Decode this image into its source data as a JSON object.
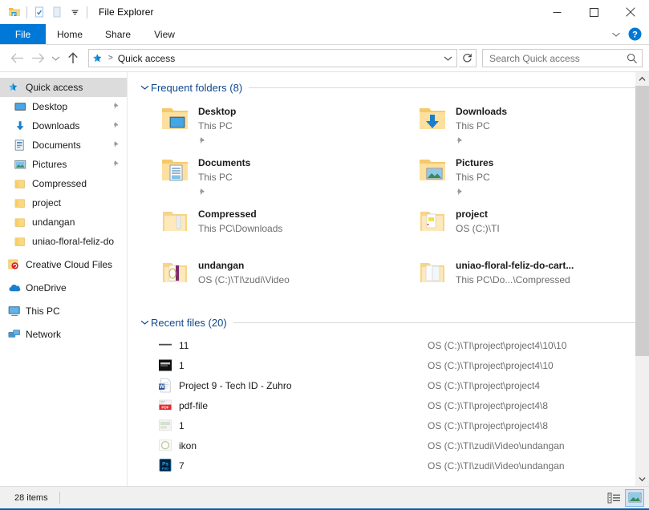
{
  "window": {
    "title": "File Explorer",
    "quick_access_toolbar": [
      {
        "name": "folder-icon",
        "label": "File Explorer"
      },
      {
        "name": "properties-icon",
        "label": "Properties"
      },
      {
        "name": "new-folder-icon",
        "label": "New folder"
      },
      {
        "name": "customize-dropdown-icon",
        "label": "Customize Quick Access Toolbar"
      }
    ],
    "controls": {
      "minimize": "Minimize",
      "maximize": "Maximize",
      "close": "Close"
    }
  },
  "ribbon": {
    "tabs": [
      {
        "label": "File",
        "active": true
      },
      {
        "label": "Home",
        "active": false
      },
      {
        "label": "Share",
        "active": false
      },
      {
        "label": "View",
        "active": false
      }
    ],
    "expand_label": "Expand the Ribbon",
    "help_label": "Help"
  },
  "navigation": {
    "back_label": "Back",
    "forward_label": "Forward",
    "recent_label": "Recent locations",
    "up_label": "Up",
    "breadcrumb": {
      "icon": "quick-access-star-icon",
      "separator": ">",
      "path": "Quick access"
    },
    "address_dropdown_label": "Previous locations",
    "refresh_label": "Refresh"
  },
  "search": {
    "placeholder": "Search Quick access",
    "value": "",
    "icon": "search-icon"
  },
  "sidebar": {
    "items": [
      {
        "label": "Quick access",
        "icon": "quick-access-star-icon",
        "selected": true,
        "pinned": false,
        "indent": "root"
      },
      {
        "label": "Desktop",
        "icon": "desktop-icon",
        "selected": false,
        "pinned": true,
        "indent": "child"
      },
      {
        "label": "Downloads",
        "icon": "downloads-arrow-icon",
        "selected": false,
        "pinned": true,
        "indent": "child"
      },
      {
        "label": "Documents",
        "icon": "documents-icon",
        "selected": false,
        "pinned": true,
        "indent": "child"
      },
      {
        "label": "Pictures",
        "icon": "pictures-icon",
        "selected": false,
        "pinned": true,
        "indent": "child"
      },
      {
        "label": "Compressed",
        "icon": "folder-icon",
        "selected": false,
        "pinned": false,
        "indent": "child"
      },
      {
        "label": "project",
        "icon": "folder-icon",
        "selected": false,
        "pinned": false,
        "indent": "child"
      },
      {
        "label": "undangan",
        "icon": "folder-icon",
        "selected": false,
        "pinned": false,
        "indent": "child"
      },
      {
        "label": "uniao-floral-feliz-do",
        "icon": "folder-icon",
        "selected": false,
        "pinned": false,
        "indent": "child"
      },
      {
        "label": "Creative Cloud Files",
        "icon": "creative-cloud-icon",
        "selected": false,
        "pinned": false,
        "indent": "root"
      },
      {
        "label": "OneDrive",
        "icon": "onedrive-cloud-icon",
        "selected": false,
        "pinned": false,
        "indent": "root"
      },
      {
        "label": "This PC",
        "icon": "this-pc-icon",
        "selected": false,
        "pinned": false,
        "indent": "root"
      },
      {
        "label": "Network",
        "icon": "network-icon",
        "selected": false,
        "pinned": false,
        "indent": "root"
      }
    ]
  },
  "main": {
    "frequent_folders": {
      "title": "Frequent folders (8)",
      "collapsed": false,
      "items": [
        {
          "name": "Desktop",
          "location": "This PC",
          "icon": "folder-desktop-icon",
          "pinned": true
        },
        {
          "name": "Downloads",
          "location": "This PC",
          "icon": "folder-downloads-icon",
          "pinned": true
        },
        {
          "name": "Documents",
          "location": "This PC",
          "icon": "folder-documents-icon",
          "pinned": true
        },
        {
          "name": "Pictures",
          "location": "This PC",
          "icon": "folder-pictures-icon",
          "pinned": true
        },
        {
          "name": "Compressed",
          "location": "This PC\\Downloads",
          "icon": "folder-generic-icon",
          "pinned": false
        },
        {
          "name": "project",
          "location": "OS (C:)\\TI",
          "icon": "folder-generic-icon",
          "pinned": false
        },
        {
          "name": "undangan",
          "location": "OS (C:)\\TI\\zudi\\Video",
          "icon": "folder-generic-icon",
          "pinned": false
        },
        {
          "name": "uniao-floral-feliz-do-cart...",
          "location": "This PC\\Do...\\Compressed",
          "icon": "folder-generic-icon",
          "pinned": false
        }
      ]
    },
    "recent_files": {
      "title": "Recent files (20)",
      "collapsed": false,
      "items": [
        {
          "name": "11",
          "path": "OS (C:)\\TI\\project\\project4\\10\\10",
          "icon": "image-thin-icon"
        },
        {
          "name": "1",
          "path": "OS (C:)\\TI\\project\\project4\\10",
          "icon": "image-dark-icon"
        },
        {
          "name": "Project 9 - Tech ID - Zuhro",
          "path": "OS (C:)\\TI\\project\\project4",
          "icon": "word-doc-icon"
        },
        {
          "name": "pdf-file",
          "path": "OS (C:)\\TI\\project\\project4\\8",
          "icon": "pdf-icon"
        },
        {
          "name": "1",
          "path": "OS (C:)\\TI\\project\\project4\\8",
          "icon": "image-light-icon"
        },
        {
          "name": "ikon",
          "path": "OS (C:)\\TI\\zudi\\Video\\undangan",
          "icon": "image-circle-icon"
        },
        {
          "name": "7",
          "path": "OS (C:)\\TI\\zudi\\Video\\undangan",
          "icon": "photoshop-psd-icon"
        }
      ]
    }
  },
  "statusbar": {
    "item_count": "28 items",
    "views": [
      {
        "name": "details-view-button",
        "label": "Details view",
        "active": false
      },
      {
        "name": "large-icons-view-button",
        "label": "Large icons view",
        "active": true
      }
    ]
  },
  "colors": {
    "accent": "#0078d7",
    "group_header": "#10478c",
    "selection": "#dcdcdc",
    "subtext": "#6d6d6d",
    "folder_yellow": "#fbd77e"
  }
}
